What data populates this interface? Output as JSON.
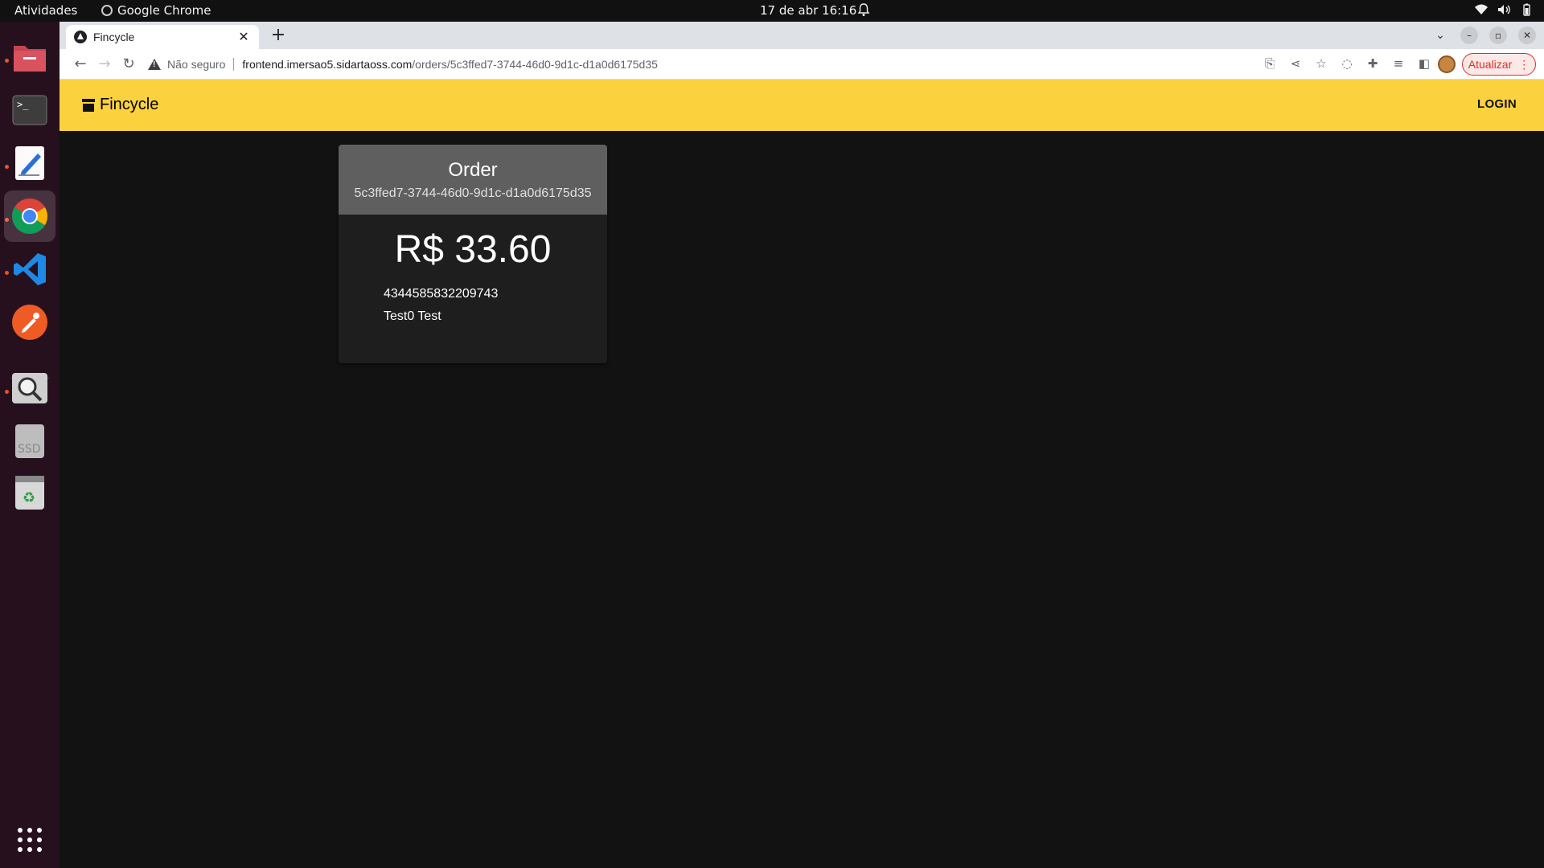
{
  "topbar": {
    "activities": "Atividades",
    "app_name": "Google Chrome",
    "clock": "17 de abr  16:16"
  },
  "dock": {
    "items": [
      "files-icon",
      "terminal-icon",
      "text-editor-icon",
      "chrome-icon",
      "vscode-icon",
      "postman-icon",
      "disk-usage-icon",
      "ssd-icon",
      "trash-icon",
      "app-grid-icon"
    ]
  },
  "browser": {
    "tab_title": "Fincycle",
    "new_tab": "+",
    "security_label": "Não seguro",
    "url_host": "frontend.imersao5.sidartaoss.com",
    "url_path": "/orders/5c3ffed7-3744-46d0-9d1c-d1a0d6175d35",
    "update_label": "Atualizar"
  },
  "app": {
    "brand": "Fincycle",
    "login_label": "LOGIN",
    "brand_color": "#fbd13e"
  },
  "order": {
    "title": "Order",
    "id": "5c3ffed7-3744-46d0-9d1c-d1a0d6175d35",
    "amount": "R$ 33.60",
    "card_number": "4344585832209743",
    "card_name": "Test0 Test"
  }
}
